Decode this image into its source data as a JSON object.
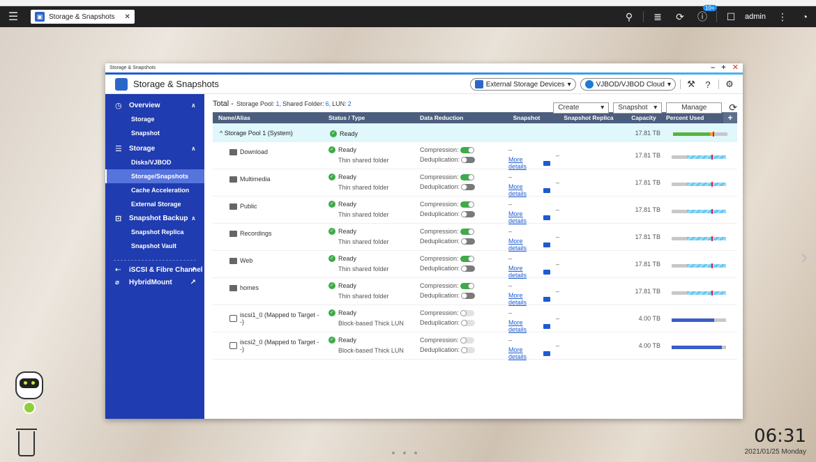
{
  "topbar": {
    "app_tab_label": "Storage & Snapshots",
    "notification_badge": "10+",
    "user": "admin"
  },
  "window": {
    "titlebar": "Storage & Snapshots",
    "header_title": "Storage & Snapshots",
    "external_storage_label": "External Storage Devices",
    "vjbod_label": "VJBOD/VJBOD Cloud"
  },
  "sidebar": {
    "overview": "Overview",
    "overview_items": [
      "Storage",
      "Snapshot"
    ],
    "storage": "Storage",
    "storage_items": [
      "Disks/VJBOD",
      "Storage/Snapshots",
      "Cache Acceleration",
      "External Storage"
    ],
    "snapshot_backup": "Snapshot Backup",
    "snapshot_items": [
      "Snapshot Replica",
      "Snapshot Vault"
    ],
    "iscsi": "iSCSI & Fibre Channel",
    "hybridmount": "HybridMount"
  },
  "summary": {
    "total_label": "Total -",
    "pool_label": "Storage Pool:",
    "pool_count": "1,",
    "folder_label": "Shared Folder:",
    "folder_count": "6,",
    "lun_label": "LUN:",
    "lun_count": "2",
    "create_button": "Create",
    "snapshot_button": "Snapshot",
    "manage_button": "Manage"
  },
  "table": {
    "headers": [
      "Name/Alias",
      "Status / Type",
      "Data Reduction",
      "Snapshot",
      "Snapshot Replica",
      "Capacity",
      "Percent Used",
      "+"
    ],
    "pool": {
      "name": "Storage Pool 1 (System)",
      "status": "Ready",
      "capacity": "17.81 TB",
      "used_fraction": 0.72
    },
    "compression_label": "Compression:",
    "dedup_label": "Deduplication:",
    "more_details": "More details",
    "dash": "–",
    "rows": [
      {
        "name": "Download",
        "kind": "folder",
        "status": "Ready",
        "type": "Thin shared folder",
        "compression": "on",
        "dedup": "off",
        "capacity": "17.81 TB"
      },
      {
        "name": "Multimedia",
        "kind": "folder",
        "status": "Ready",
        "type": "Thin shared folder",
        "compression": "on",
        "dedup": "off",
        "capacity": "17.81 TB"
      },
      {
        "name": "Public",
        "kind": "folder",
        "status": "Ready",
        "type": "Thin shared folder",
        "compression": "on",
        "dedup": "off",
        "capacity": "17.81 TB"
      },
      {
        "name": "Recordings",
        "kind": "folder",
        "status": "Ready",
        "type": "Thin shared folder",
        "compression": "on",
        "dedup": "off",
        "capacity": "17.81 TB"
      },
      {
        "name": "Web",
        "kind": "folder",
        "status": "Ready",
        "type": "Thin shared folder",
        "compression": "on",
        "dedup": "off",
        "capacity": "17.81 TB"
      },
      {
        "name": "homes",
        "kind": "folder",
        "status": "Ready",
        "type": "Thin shared folder",
        "compression": "on",
        "dedup": "off",
        "capacity": "17.81 TB"
      },
      {
        "name": "iscsi1_0 (Mapped to Target --)",
        "kind": "lun",
        "status": "Ready",
        "type": "Block-based Thick LUN",
        "compression": "disabled",
        "dedup": "disabled",
        "capacity": "4.00 TB"
      },
      {
        "name": "iscsi2_0 (Mapped to Target --)",
        "kind": "lun",
        "status": "Ready",
        "type": "Block-based Thick LUN",
        "compression": "disabled",
        "dedup": "disabled",
        "capacity": "4.00 TB"
      }
    ]
  },
  "desktop": {
    "time": "06:31",
    "date": "2021/01/25 Monday"
  },
  "colors": {
    "sidebar": "#1f3cb0",
    "header": "#4c5e7e",
    "ok": "#3dab47",
    "link": "#1d5bd3"
  }
}
